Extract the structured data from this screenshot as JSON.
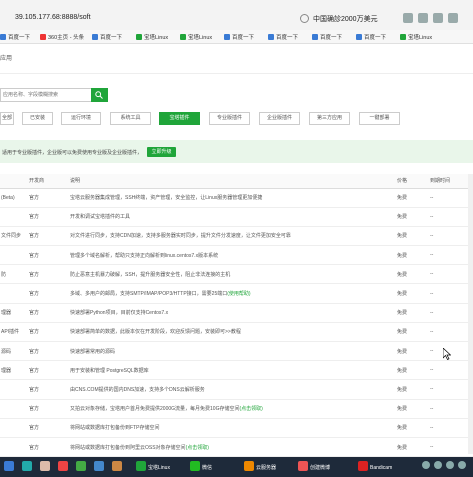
{
  "browser": {
    "url": "39.105.177.68:8888/soft",
    "search_text": "中国确診2000万美元",
    "bookmarks": [
      "百度一下",
      "360主页 - 头条",
      "百度一下",
      "宝塔Linux",
      "宝塔Linux",
      "百度一下",
      "百度一下",
      "百度一下",
      "百度一下",
      "宝塔Linux"
    ]
  },
  "page": {
    "crumb": "应用",
    "search_placeholder": "应用名称、字段模糊搜索"
  },
  "categories": [
    "全部",
    "已安装",
    "运行环境",
    "系统工具",
    "宝塔插件",
    "专业版插件",
    "企业版插件",
    "第三方应用",
    "一键部署"
  ],
  "active_category_index": 4,
  "notice": {
    "text": "适用于专业版插件，企业版可以免费使用专业版及企业版插件，",
    "button": "立即升级"
  },
  "table": {
    "headers": [
      "",
      "开发商",
      "说明",
      "价格",
      "到期时间"
    ],
    "rows": [
      {
        "name": "(Beta)",
        "dev": "官方",
        "desc": "宝塔云服务器集成管理，SSH终端，资产管理，安全监控，让Linux服务器管理更加便捷",
        "link": "",
        "price": "免费",
        "exp": "--"
      },
      {
        "name": "",
        "dev": "官方",
        "desc": "开发和调试宝塔插件的工具",
        "link": "",
        "price": "免费",
        "exp": "--"
      },
      {
        "name": "文件同步",
        "dev": "官方",
        "desc": "对文件进行同步，支持CDN加速，支持多服务器实时同步，提升文件分发速度，让文件更加安全可靠",
        "link": "",
        "price": "免费",
        "exp": "--"
      },
      {
        "name": "",
        "dev": "官方",
        "desc": "管理多个域名解析，帮助只支持正向解析到linux.centos7.x版本系统",
        "link": "",
        "price": "免费",
        "exp": "--"
      },
      {
        "name": "防",
        "dev": "官方",
        "desc": "防止恶意主机暴力破解，SSH，提升服务器安全性，阻止非法连接的主机",
        "link": "",
        "price": "免费",
        "exp": "--"
      },
      {
        "name": "",
        "dev": "官方",
        "desc": "多域、多用户的邮局，支持SMTP/IMAP/POP3/HTTP接口，需要25端口",
        "link": "(使用帮助)",
        "price": "免费",
        "exp": "--"
      },
      {
        "name": "理器",
        "dev": "官方",
        "desc": "快速部署Python项目，目前仅支持Centos7.x",
        "link": "",
        "price": "免费",
        "exp": "--"
      },
      {
        "name": "API插件",
        "dev": "官方",
        "desc": "快速部署简单的数据，此版本仅在开发阶段，欢迎反馈问题，安装即可>>教程",
        "link": "",
        "price": "免费",
        "exp": "--"
      },
      {
        "name": "源码",
        "dev": "官方",
        "desc": "快速部署常用的源码",
        "link": "",
        "price": "免费",
        "exp": "--"
      },
      {
        "name": "理器",
        "dev": "官方",
        "desc": "用于安装和管理 PostgreSQL数据库",
        "link": "",
        "price": "免费",
        "exp": "--"
      },
      {
        "name": "",
        "dev": "官方",
        "desc": "由CNS.COM提供的国内DNS加速，支持多个DNS云解析服务",
        "link": "",
        "price": "免费",
        "exp": "--"
      },
      {
        "name": "",
        "dev": "官方",
        "desc": "又拍云对象存储，宝塔用户首月免费提供2000G流量，每月免费10G存储空间",
        "link": "(点击领取)",
        "price": "免费",
        "exp": "--"
      },
      {
        "name": "",
        "dev": "官方",
        "desc": "将网站或数据库打包备份到FTP存储空间",
        "link": "",
        "price": "免费",
        "exp": "--"
      },
      {
        "name": "",
        "dev": "官方",
        "desc": "将网站或数据库打包备份到阿里云OSS对象存储空间",
        "link": "(点击领取)",
        "price": "免费",
        "exp": "--"
      }
    ]
  },
  "taskbar": {
    "apps": [
      "宝塔Linux",
      "微信",
      "云服务器",
      "创建微博",
      "Bandicam"
    ]
  },
  "colors": {
    "accent": "#20a53a",
    "notice_bg": "#e9f6ea",
    "taskbar": "#1e2a3a"
  }
}
